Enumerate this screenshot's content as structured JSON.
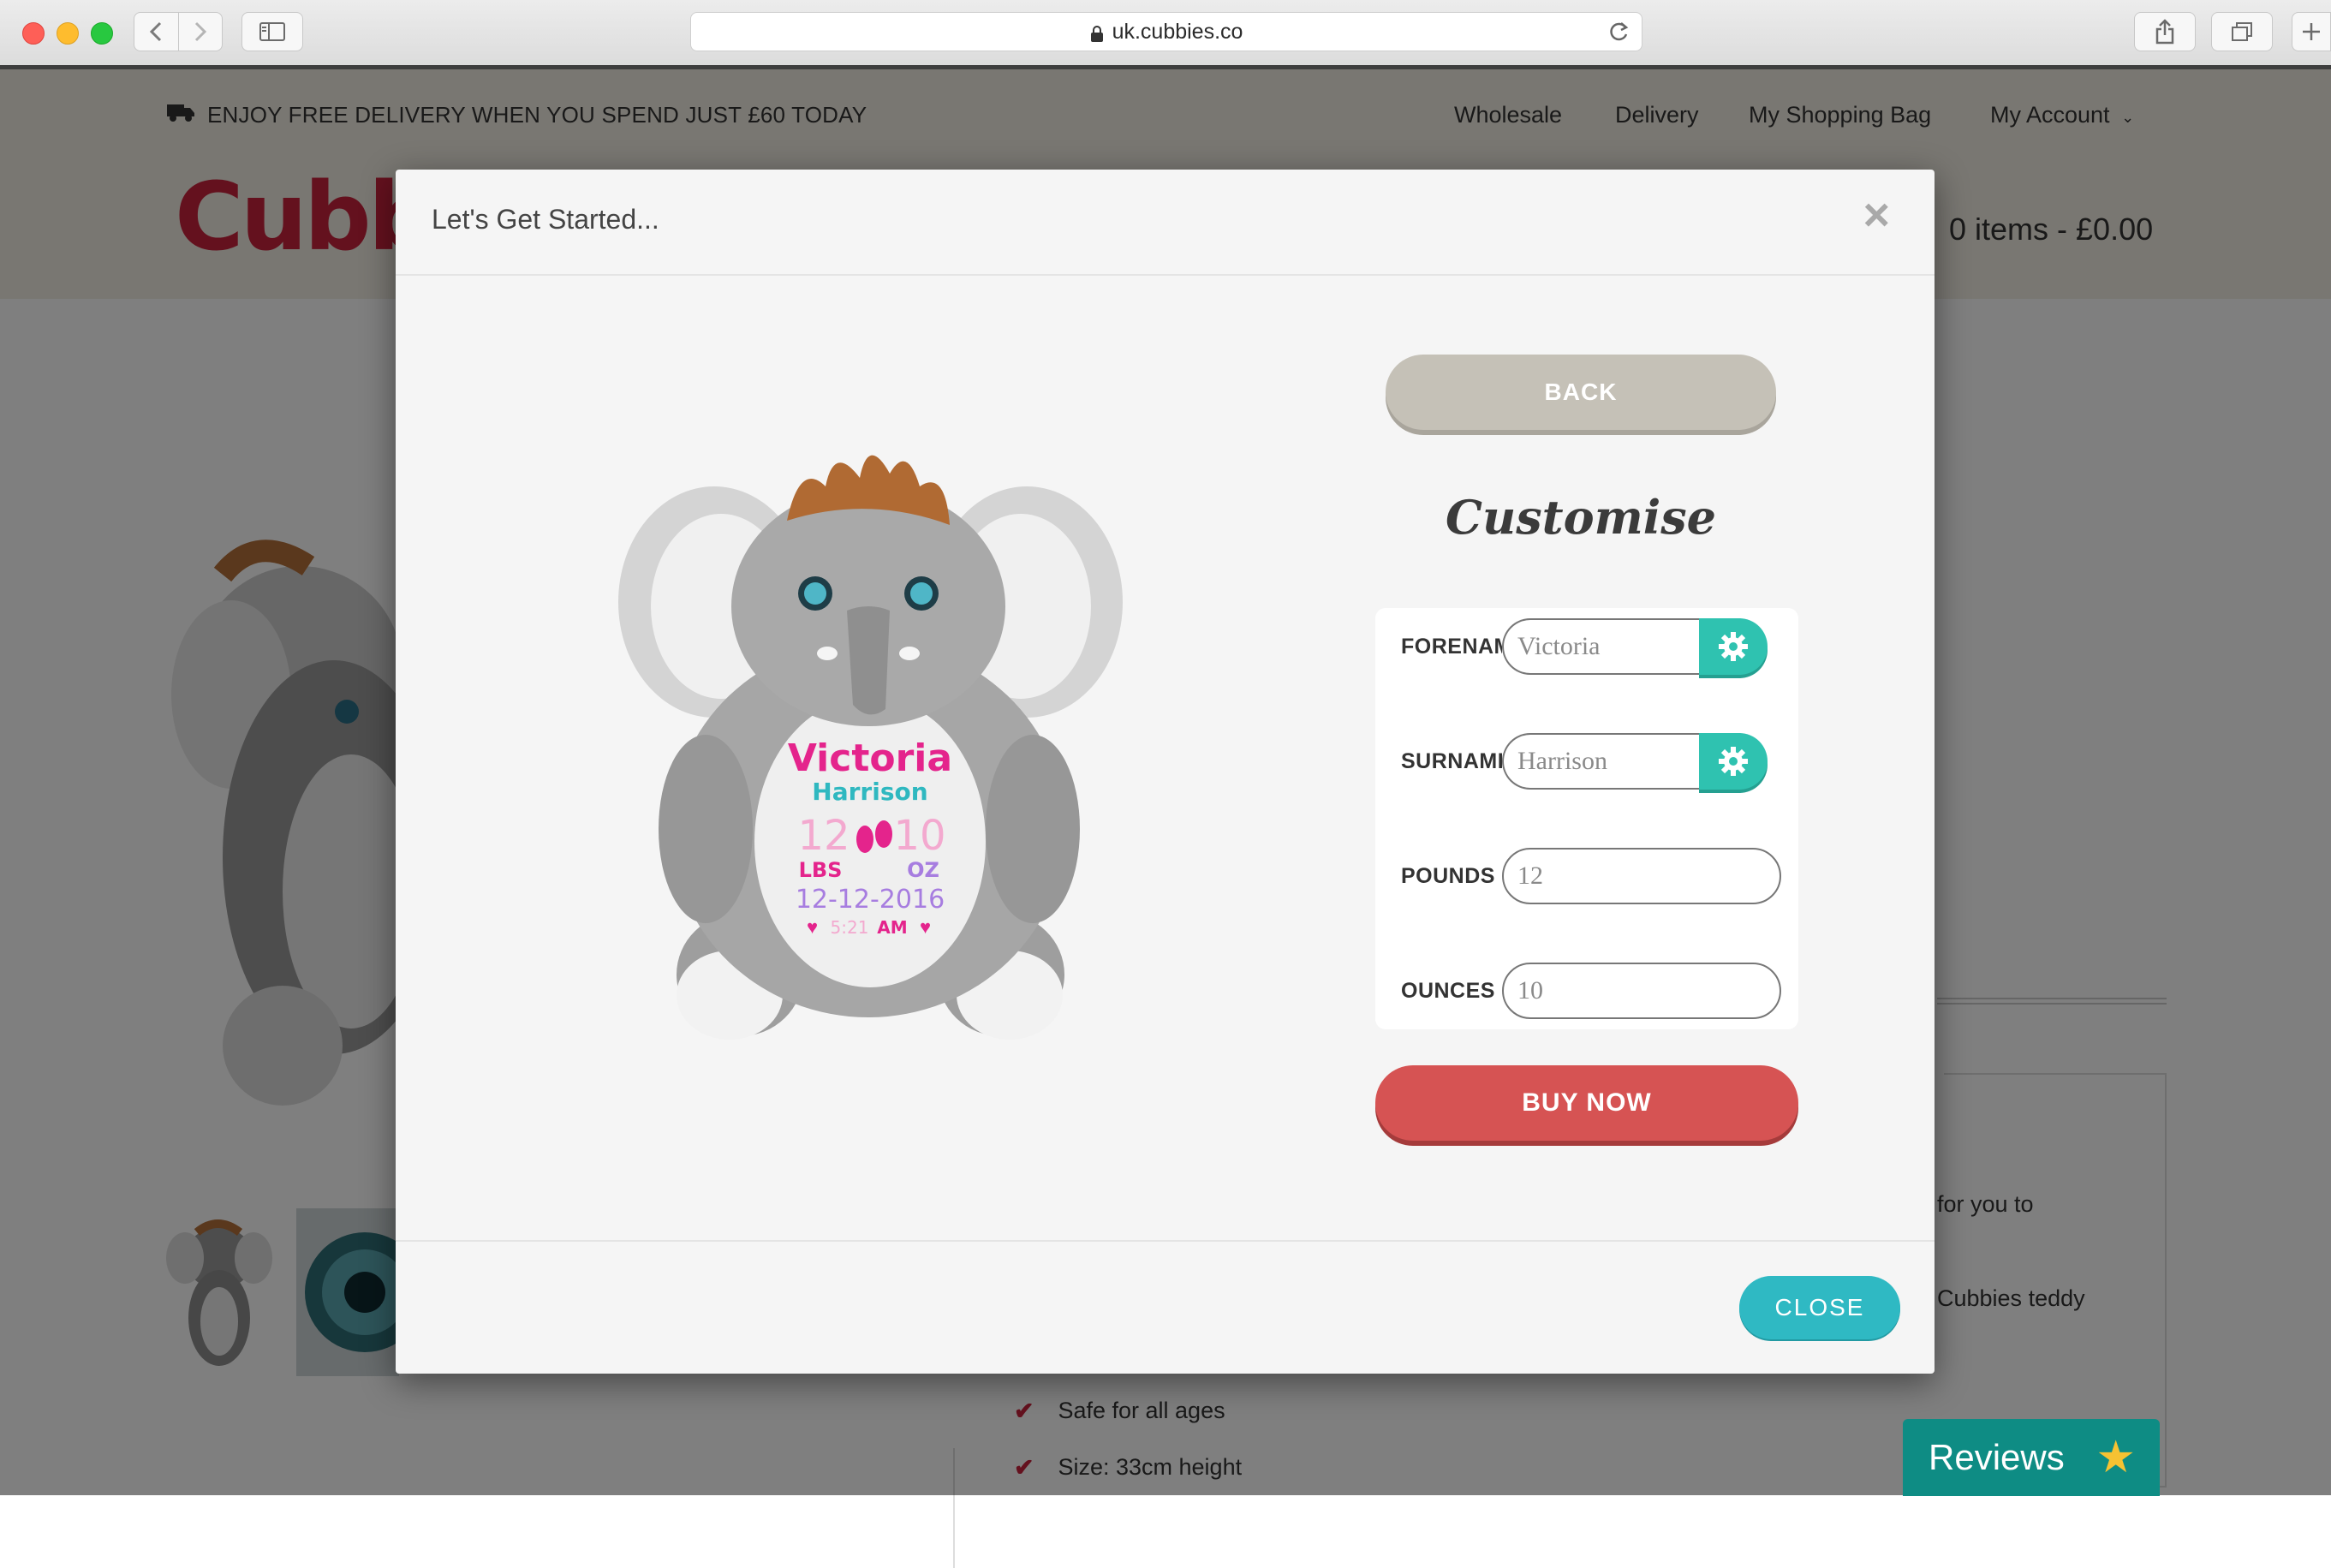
{
  "browser": {
    "url": "uk.cubbies.co",
    "buttons": [
      "back",
      "forward",
      "sidebar",
      "reload",
      "share",
      "tabs",
      "new-tab"
    ]
  },
  "page": {
    "promo": "ENJOY FREE DELIVERY WHEN YOU SPEND JUST £60 TODAY",
    "nav": {
      "wholesale": "Wholesale",
      "delivery": "Delivery",
      "shopping_bag": "My Shopping Bag",
      "account": "My Account"
    },
    "logo_text": "Cubbi",
    "cart": "0 items - £0.00",
    "side_text_1": "for you to",
    "side_text_2": "Cubbies teddy",
    "features": [
      "Safe for all ages",
      "Size: 33cm height"
    ],
    "reviews": "Reviews"
  },
  "modal": {
    "title": "Let's Get Started...",
    "back_label": "BACK",
    "customise_heading": "Customise",
    "fields": {
      "forename": {
        "label": "FORENAME",
        "value": "Victoria"
      },
      "surname": {
        "label": "SURNAME",
        "value": "Harrison"
      },
      "pounds": {
        "label": "POUNDS",
        "value": "12"
      },
      "ounces": {
        "label": "OUNCES",
        "value": "10"
      }
    },
    "buy_label": "BUY NOW",
    "close_label": "CLOSE",
    "preview": {
      "name": "Victoria",
      "surname": "Harrison",
      "lbs_num": "12",
      "oz_num": "10",
      "lbs": "LBS",
      "oz": "OZ",
      "date": "12-12-2016",
      "time": "5:21",
      "ampm": "AM"
    }
  },
  "colors": {
    "accent_teal": "#2fb9c3",
    "gear_green": "#2fc2b0",
    "buy_red": "#d65353",
    "back_grey": "#c5c1b7",
    "brand_red": "#c8233c"
  }
}
